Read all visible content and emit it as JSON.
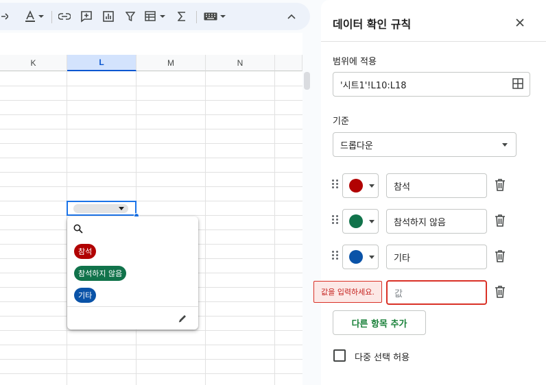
{
  "toolbar": {
    "items": [
      "fill-color-icon",
      "text-color-icon",
      "link-icon",
      "comment-icon",
      "chart-icon",
      "filter-icon",
      "filter-views-icon",
      "functions-icon",
      "input-tools-icon",
      "collapse-icon"
    ]
  },
  "sheet": {
    "columns": [
      "K",
      "L",
      "M",
      "N"
    ],
    "selected_column": "L"
  },
  "popup": {
    "options": [
      {
        "label": "참석",
        "color": "#b10202"
      },
      {
        "label": "참석하지 않음",
        "color": "#11734b"
      },
      {
        "label": "기타",
        "color": "#0a53a8"
      }
    ]
  },
  "panel": {
    "title": "데이터 확인 규칙",
    "apply_label": "범위에 적용",
    "range_value": "'시트1'!L10:L18",
    "criteria_label": "기준",
    "criteria_value": "드롭다운",
    "items": [
      {
        "value": "참석",
        "color": "#b10202"
      },
      {
        "value": "참석하지 않음",
        "color": "#11734b"
      },
      {
        "value": "기타",
        "color": "#0a53a8"
      }
    ],
    "new_item_placeholder": "값",
    "error_tooltip": "값을 입력하세요.",
    "add_button": "다른 항목 추가",
    "multi_select_label": "다중 선택 허용",
    "multi_select_checked": false
  }
}
